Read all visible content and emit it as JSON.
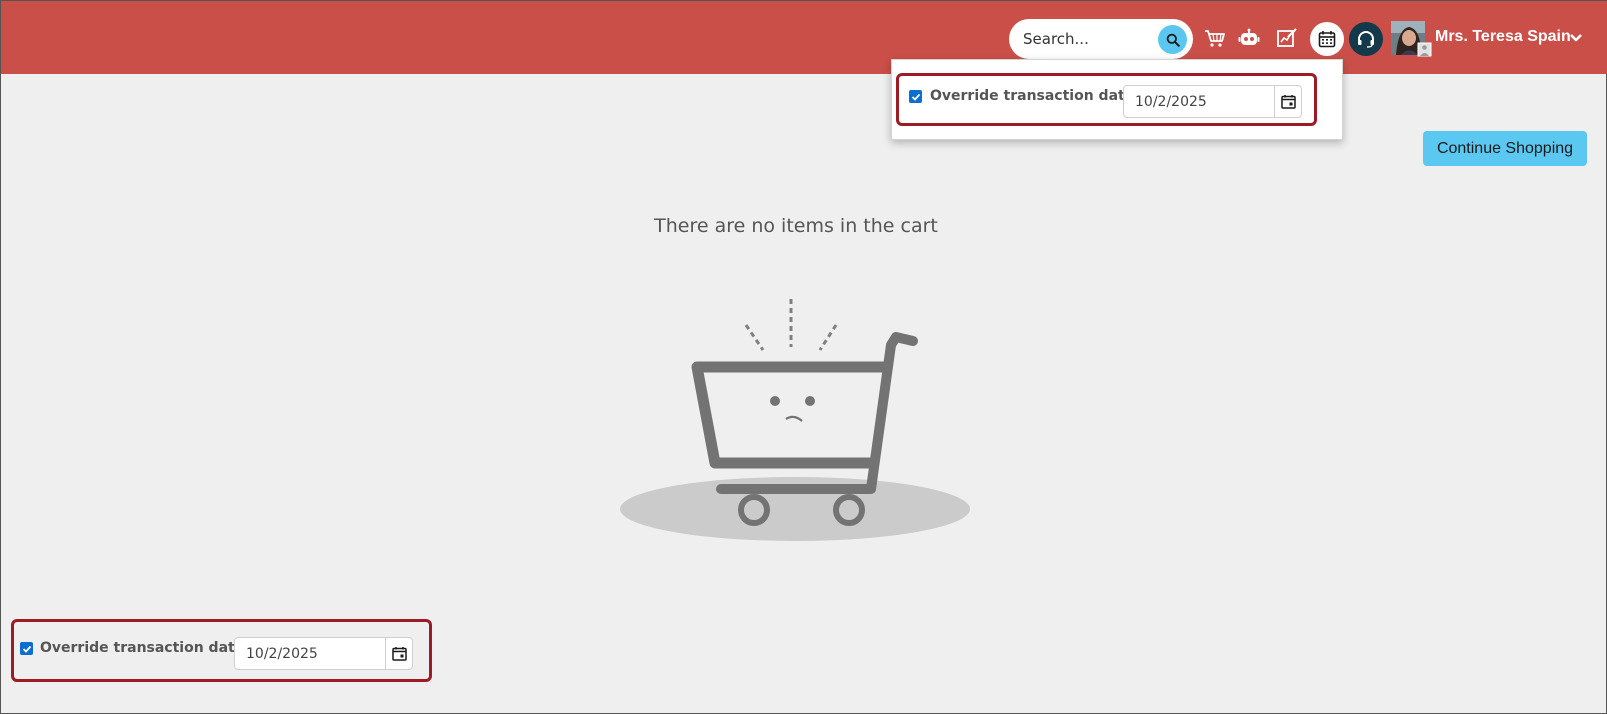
{
  "header": {
    "search": {
      "placeholder": "Search..."
    },
    "user": {
      "name": "Mrs. Teresa Spain"
    },
    "icons": [
      "cart-icon",
      "robot-icon",
      "edit-report-icon",
      "calendar-icon",
      "headset-icon"
    ]
  },
  "date_popup": {
    "checkbox_checked": true,
    "label": "Override transaction date",
    "date": "10/2/2025"
  },
  "main": {
    "continue_label": "Continue Shopping",
    "empty_message": "There are no items in the cart"
  },
  "bottom_override": {
    "checkbox_checked": true,
    "label": "Override transaction date",
    "date": "10/2/2025"
  },
  "colors": {
    "header_bg": "#cb4f49",
    "accent_blue": "#5ac8f1",
    "highlight_frame": "#9d1b24",
    "headset_bg": "#13394a"
  }
}
